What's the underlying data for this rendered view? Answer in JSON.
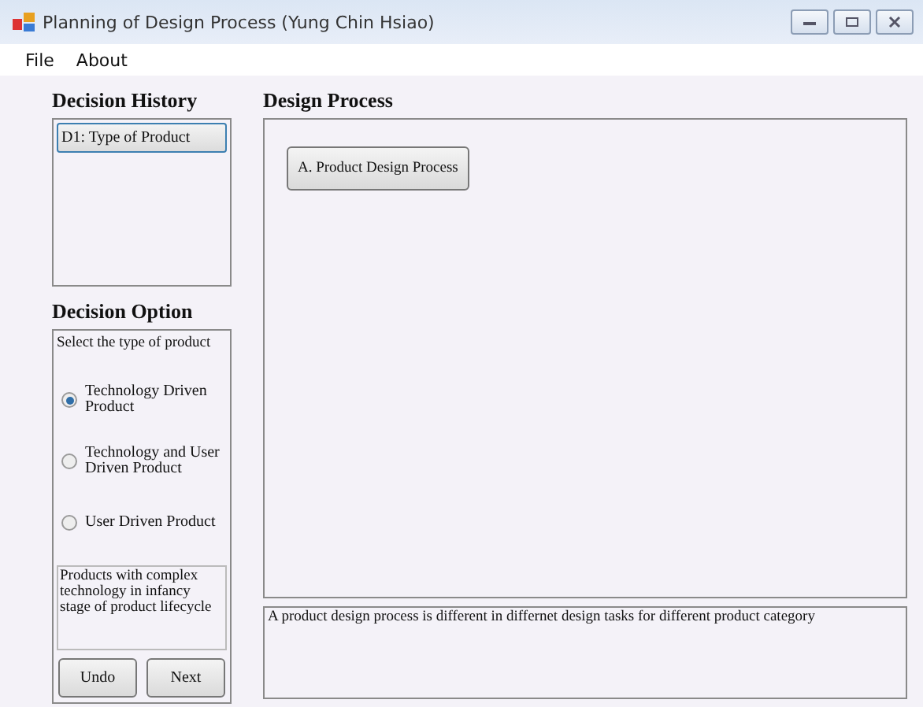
{
  "window": {
    "title": "Planning of Design Process (Yung Chin Hsiao)"
  },
  "menu": [
    "File",
    "About"
  ],
  "decision_history": {
    "title": "Decision History",
    "items": [
      {
        "label": "D1: Type of Product",
        "selected": true
      }
    ]
  },
  "decision_option": {
    "title": "Decision Option",
    "prompt": "Select the type of product",
    "options": [
      {
        "label": "Technology Driven Product",
        "selected": true
      },
      {
        "label": "Technology and User Driven Product",
        "selected": false
      },
      {
        "label": "User Driven Product",
        "selected": false
      }
    ],
    "description": "Products with complex technology in infancy stage of product lifecycle",
    "buttons": [
      "Undo",
      "Next"
    ]
  },
  "design_process": {
    "title": "Design Process",
    "nodes": [
      "A. Product Design Process"
    ],
    "note": "A product design process is different in differnet design tasks for different product category"
  }
}
